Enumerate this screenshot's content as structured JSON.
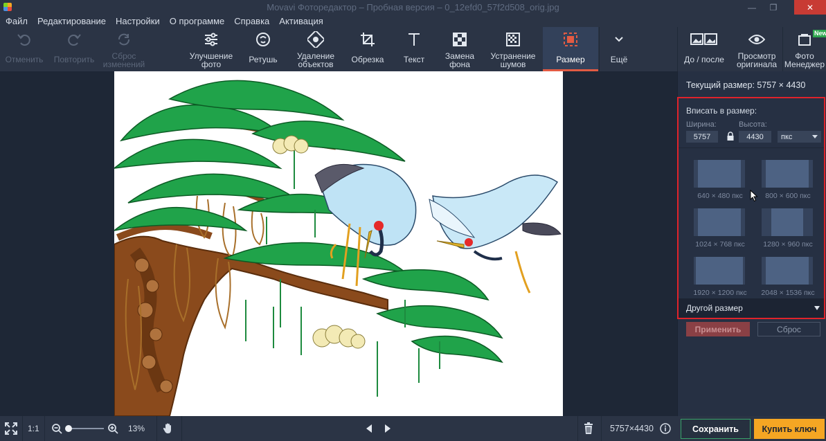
{
  "window": {
    "title": "Movavi Фоторедактор – Пробная версия – 0_12efd0_57f2d508_orig.jpg"
  },
  "menu": [
    "Файл",
    "Редактирование",
    "Настройки",
    "О программе",
    "Справка",
    "Активация"
  ],
  "toolbar": {
    "undo": "Отменить",
    "redo": "Повторить",
    "reset1": "Сброс",
    "reset2": "изменений",
    "enhance1": "Улучшение",
    "enhance2": "фото",
    "retouch": "Ретушь",
    "remove1": "Удаление",
    "remove2": "объектов",
    "crop": "Обрезка",
    "text": "Текст",
    "bg1": "Замена",
    "bg2": "фона",
    "denoise1": "Устранение",
    "denoise2": "шумов",
    "resize": "Размер",
    "more": "Ещё",
    "before_after": "До / после",
    "view1": "Просмотр",
    "view2": "оригинала",
    "mgr1": "Фото",
    "mgr2": "Менеджер",
    "new_badge": "New"
  },
  "panel": {
    "current_size": "Текущий размер: 5757 × 4430",
    "fit_title": "Вписать в размер:",
    "width_label": "Ширина:",
    "height_label": "Высота:",
    "width_value": "5757",
    "height_value": "4430",
    "unit": "пкс",
    "presets": [
      "640 × 480 пкс",
      "800 × 600 пкс",
      "1024 × 768 пкс",
      "1280 × 960 пкс",
      "1920 × 1200 пкс",
      "2048 × 1536 пкс"
    ],
    "other_size": "Другой размер",
    "apply": "Применить",
    "reset": "Сброс"
  },
  "bottom": {
    "one_to_one": "1:1",
    "zoom": "13%",
    "dimensions": "5757×4430",
    "save": "Сохранить",
    "buy": "Купить ключ"
  },
  "colors": {
    "accent": "#e25b43",
    "highlight_border": "#e0232b",
    "save_border": "#38a36a",
    "buy_bg": "#f5a623"
  }
}
